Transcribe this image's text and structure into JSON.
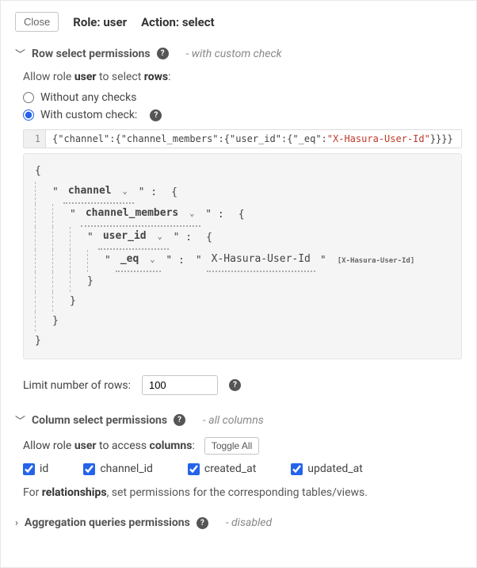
{
  "header": {
    "close_label": "Close",
    "role_label": "Role:",
    "role_value": "user",
    "action_label": "Action:",
    "action_value": "select"
  },
  "row_perms": {
    "title": "Row select permissions",
    "note": "- with custom check",
    "allow_prefix": "Allow role ",
    "allow_role": "user",
    "allow_middle": " to select ",
    "allow_target": "rows",
    "allow_suffix": ":",
    "radio_without": "Without any checks",
    "radio_with": "With custom check:",
    "selected": "with",
    "code_gutter": "1",
    "code_plain_a": "{\"channel\":{\"channel_members\":{\"user_id\":{\"_eq\":",
    "code_string": "\"X-Hasura-User-Id\"",
    "code_plain_b": "}}}}",
    "tree": {
      "k1": "channel",
      "k2": "channel_members",
      "k3": "user_id",
      "k4": "_eq",
      "value": "X-Hasura-User-Id",
      "badge": "[X-Hasura-User-Id]"
    },
    "limit_label": "Limit number of rows:",
    "limit_value": "100"
  },
  "col_perms": {
    "title": "Column select permissions",
    "note": "- all columns",
    "allow_prefix": "Allow role ",
    "allow_role": "user",
    "allow_middle": " to access ",
    "allow_target": "columns",
    "allow_suffix": ":",
    "toggle_label": "Toggle All",
    "columns": [
      "id",
      "channel_id",
      "created_at",
      "updated_at"
    ],
    "rel_prefix": "For ",
    "rel_bold": "relationships",
    "rel_suffix": ", set permissions for the corresponding tables/views."
  },
  "agg_perms": {
    "title": "Aggregation queries permissions",
    "note": "- disabled"
  }
}
